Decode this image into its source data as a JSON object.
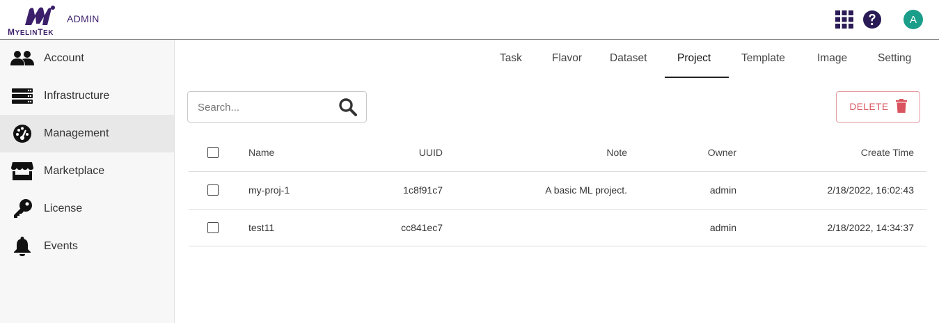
{
  "header": {
    "brand_word_first": "M",
    "brand_word_mid": "YELIN",
    "brand_word_tail": "T",
    "brand_word_end": "EK",
    "role_label": "ADMIN",
    "avatar_letter": "A",
    "brand_color": "#3b1f6a",
    "avatar_color": "#1a9e8a"
  },
  "sidebar": {
    "items": [
      {
        "label": "Account",
        "icon": "users-icon"
      },
      {
        "label": "Infrastructure",
        "icon": "server-icon"
      },
      {
        "label": "Management",
        "icon": "dashboard-gauge-icon",
        "active": true
      },
      {
        "label": "Marketplace",
        "icon": "store-icon"
      },
      {
        "label": "License",
        "icon": "key-icon"
      },
      {
        "label": "Events",
        "icon": "bell-icon"
      }
    ]
  },
  "tabs": [
    {
      "label": "Task"
    },
    {
      "label": "Flavor"
    },
    {
      "label": "Dataset"
    },
    {
      "label": "Project",
      "active": true
    },
    {
      "label": "Template"
    },
    {
      "label": "Image"
    },
    {
      "label": "Setting"
    }
  ],
  "search": {
    "placeholder": "Search...",
    "value": ""
  },
  "toolbar": {
    "delete_label": "DELETE",
    "delete_color": "#d9545e"
  },
  "table": {
    "headers": {
      "name": "Name",
      "uuid": "UUID",
      "note": "Note",
      "owner": "Owner",
      "create_time": "Create Time"
    },
    "rows": [
      {
        "name": "my-proj-1",
        "uuid": "1c8f91c7",
        "note": "A basic ML project.",
        "owner": "admin",
        "create_time": "2/18/2022, 16:02:43"
      },
      {
        "name": "test11",
        "uuid": "cc841ec7",
        "note": "",
        "owner": "admin",
        "create_time": "2/18/2022, 14:34:37"
      }
    ]
  }
}
